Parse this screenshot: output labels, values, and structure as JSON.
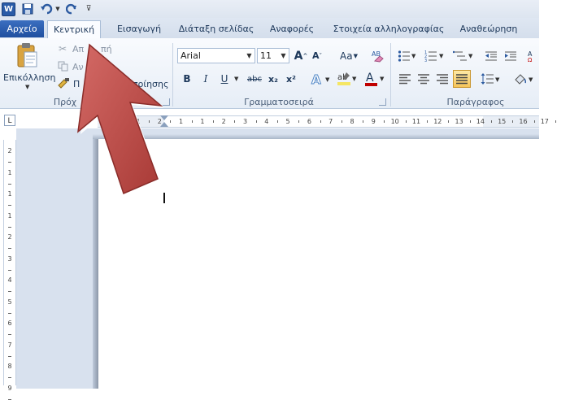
{
  "quick_access": {
    "app_icon": "W",
    "icons": [
      "save-icon",
      "undo-icon",
      "redo-icon",
      "customize-icon"
    ]
  },
  "tabs": {
    "file": "Αρχείο",
    "home": "Κεντρική",
    "insert": "Εισαγωγή",
    "page_layout": "Διάταξη σελίδας",
    "references": "Αναφορές",
    "mailings": "Στοιχεία αλληλογραφίας",
    "review": "Αναθεώρηση"
  },
  "clipboard": {
    "paste": "Επικόλληση",
    "cut_partial": "Απ",
    "cut_partial_end": "πή",
    "copy_partial": "Αν",
    "format_painter_partial": "Π",
    "format_painter_end": "ποίησης",
    "group_label_partial": "Πρόχ"
  },
  "font": {
    "name": "Arial",
    "size": "11",
    "grow_label": "A",
    "shrink_label": "A",
    "change_case": "Aa",
    "bold": "B",
    "italic": "I",
    "underline": "U",
    "strikethrough": "abc",
    "subscript": "x₂",
    "superscript": "x²",
    "group_label": "Γραμματοσειρά"
  },
  "paragraph": {
    "group_label": "Παράγραφος"
  },
  "ruler": {
    "corner_symbol": "L",
    "h_marks": [
      "1",
      "2",
      "1",
      "1",
      "2",
      "3",
      "4",
      "5",
      "6",
      "7",
      "8",
      "9",
      "10",
      "11",
      "12",
      "13",
      "14",
      "15",
      "16",
      "17"
    ],
    "v_marks": [
      "2",
      "1",
      "1",
      "1",
      "2",
      "3",
      "4",
      "5",
      "6",
      "7",
      "8",
      "9"
    ]
  },
  "colors": {
    "file_tab": "#2a5ca8",
    "arrow_fill": "#c0504d",
    "highlight": "#f5e663",
    "font_color": "#c00000"
  }
}
